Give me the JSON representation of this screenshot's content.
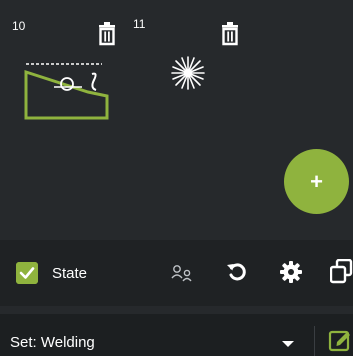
{
  "canvas": {
    "items": [
      {
        "number": "10",
        "icon": "trash-icon",
        "thumbnail": "welding-part-icon"
      },
      {
        "number": "11",
        "icon": "trash-icon",
        "thumbnail": "spark-icon"
      }
    ],
    "add_button": {
      "label": "+"
    }
  },
  "toolbar": {
    "state_checked": true,
    "state_label": "State",
    "icons": [
      "people-swap-icon",
      "undo-icon",
      "gear-icon",
      "copy-icon"
    ]
  },
  "setbar": {
    "label": "Set: Welding",
    "edit_icon": "edit-icon"
  },
  "colors": {
    "accent": "#8fb33e",
    "background": "#26292c",
    "toolbar": "#1f2224"
  }
}
